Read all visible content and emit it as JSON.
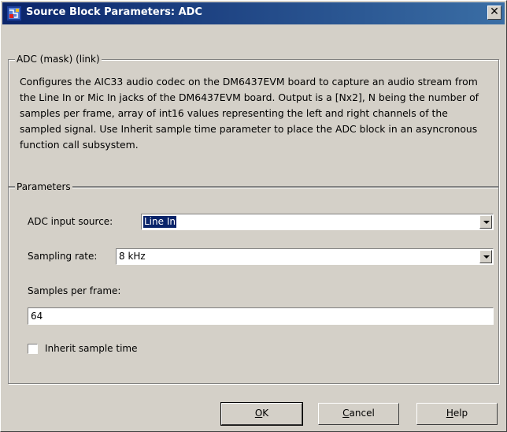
{
  "window": {
    "title": "Source Block Parameters: ADC",
    "close_label": "✕"
  },
  "description": {
    "legend": "ADC (mask) (link)",
    "text": "Configures the AIC33 audio codec on the DM6437EVM board to capture an audio stream from the Line In or Mic In jacks of the DM6437EVM board. Output is a [Nx2], N being the number of samples per frame, array of int16 values representing the left and right channels of the sampled signal. Use Inherit sample time parameter to place the ADC block in an asyncronous function call subsystem."
  },
  "parameters": {
    "legend": "Parameters",
    "adc_input_source": {
      "label": "ADC input source:",
      "value": "Line In"
    },
    "sampling_rate": {
      "label": "Sampling rate:",
      "value": "8 kHz"
    },
    "samples_per_frame": {
      "label": "Samples per frame:",
      "value": "64"
    },
    "inherit_sample_time": {
      "label": "Inherit sample time",
      "checked": false
    }
  },
  "buttons": {
    "ok": {
      "underline": "O",
      "rest": "K"
    },
    "cancel": {
      "underline": "C",
      "rest": "ancel"
    },
    "help": {
      "underline": "H",
      "rest": "elp"
    }
  }
}
